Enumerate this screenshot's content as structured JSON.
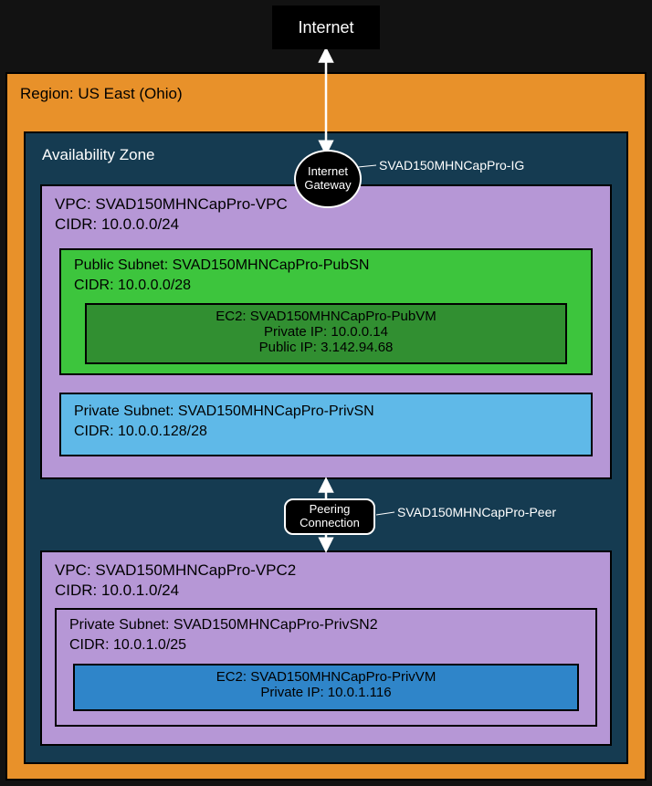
{
  "internet": {
    "label": "Internet"
  },
  "region": {
    "label": "Region: US East (Ohio)"
  },
  "az": {
    "label": "Availability Zone"
  },
  "igw": {
    "line1": "Internet",
    "line2": "Gateway",
    "name": "SVAD150MHNCapPro-IG"
  },
  "vpc1": {
    "name_line": "VPC: SVAD150MHNCapPro-VPC",
    "cidr_line": "CIDR: 10.0.0.0/24",
    "pub_subnet": {
      "name_line": "Public Subnet: SVAD150MHNCapPro-PubSN",
      "cidr_line": "CIDR: 10.0.0.0/28",
      "ec2": {
        "name_line": "EC2: SVAD150MHNCapPro-PubVM",
        "priv_ip_line": "Private IP: 10.0.0.14",
        "pub_ip_line": "Public IP: 3.142.94.68"
      }
    },
    "priv_subnet": {
      "name_line": "Private Subnet: SVAD150MHNCapPro-PrivSN",
      "cidr_line": "CIDR: 10.0.0.128/28"
    }
  },
  "peer": {
    "line1": "Peering",
    "line2": "Connection",
    "name": "SVAD150MHNCapPro-Peer"
  },
  "vpc2": {
    "name_line": "VPC: SVAD150MHNCapPro-VPC2",
    "cidr_line": "CIDR: 10.0.1.0/24",
    "priv_subnet": {
      "name_line": "Private Subnet: SVAD150MHNCapPro-PrivSN2",
      "cidr_line": "CIDR: 10.0.1.0/25",
      "ec2": {
        "name_line": "EC2: SVAD150MHNCapPro-PrivVM",
        "priv_ip_line": "Private IP: 10.0.1.116"
      }
    }
  }
}
